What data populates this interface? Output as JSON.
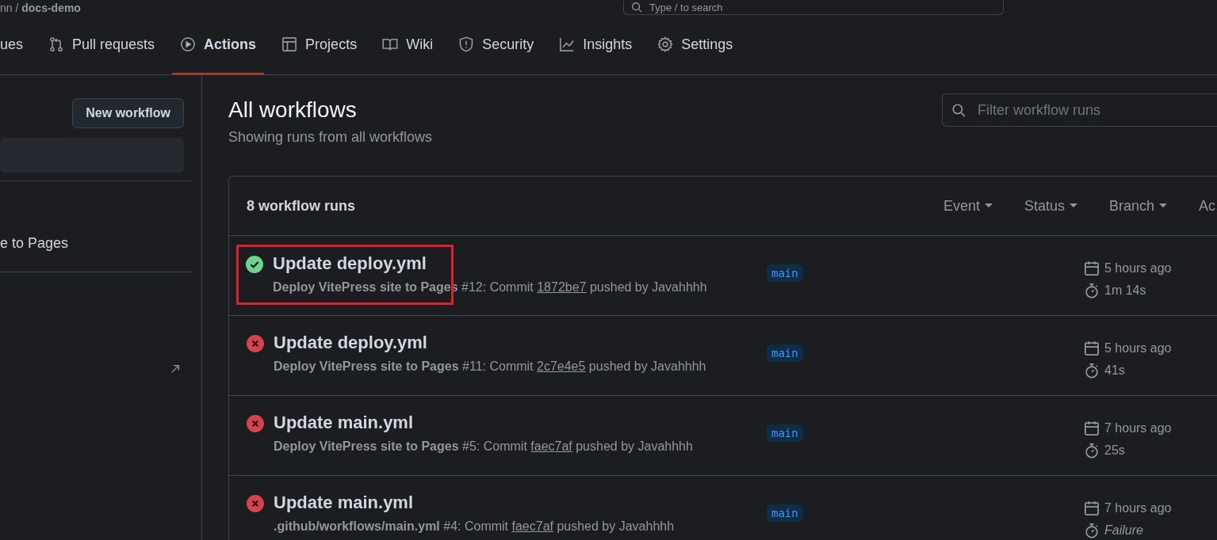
{
  "header": {
    "path": "nn / **docs-demo**",
    "search_placeholder": "Type / to search"
  },
  "tabs": [
    {
      "label": "ues",
      "selected": false
    },
    {
      "label": "Pull requests",
      "selected": false
    },
    {
      "label": "Actions",
      "selected": true
    },
    {
      "label": "Projects",
      "selected": false
    },
    {
      "label": "Wiki",
      "selected": false
    },
    {
      "label": "Security",
      "selected": false
    },
    {
      "label": "Insights",
      "selected": false
    },
    {
      "label": "Settings",
      "selected": false
    }
  ],
  "sidebar": {
    "new_button": "New workflow",
    "items": [
      {
        "selected": true
      },
      {
        "label": "e to Pages",
        "selected": false
      }
    ]
  },
  "main": {
    "title": "All workflows",
    "subtitle": "Showing runs from all workflows",
    "filter_placeholder": "Filter workflow runs"
  },
  "runs_table": {
    "count": "8 workflow runs",
    "filters": [
      "Event",
      "Status",
      "Branch",
      "Ac"
    ],
    "rows": [
      {
        "kind": "success",
        "title": "Update deploy.yml",
        "workflow": "Deploy VitePress site to Pages",
        "number": "#12: Commit",
        "commit": "1872be7",
        "pushed_by": "pushed by Javahhhh",
        "branch": "main",
        "time": "5 hours ago",
        "duration": "1m 14s",
        "duration_italic": false,
        "highlighted": true
      },
      {
        "kind": "failure",
        "title": "Update deploy.yml",
        "workflow": "Deploy VitePress site to Pages",
        "number": "#11: Commit",
        "commit": "2c7e4e5",
        "pushed_by": "pushed by Javahhhh",
        "branch": "main",
        "time": "5 hours ago",
        "duration": "41s",
        "duration_italic": false,
        "highlighted": false
      },
      {
        "kind": "failure",
        "title": "Update main.yml",
        "workflow": "Deploy VitePress site to Pages",
        "number": "#5: Commit",
        "commit": "faec7af",
        "pushed_by": "pushed by Javahhhh",
        "branch": "main",
        "time": "7 hours ago",
        "duration": "25s",
        "duration_italic": false,
        "highlighted": false
      },
      {
        "kind": "failure",
        "title": "Update main.yml",
        "workflow": ".github/workflows/main.yml",
        "number": "#4: Commit",
        "commit": "faec7af",
        "pushed_by": "pushed by Javahhhh",
        "branch": "main",
        "time": "7 hours ago",
        "duration": "Failure",
        "duration_italic": true,
        "highlighted": false
      }
    ]
  }
}
